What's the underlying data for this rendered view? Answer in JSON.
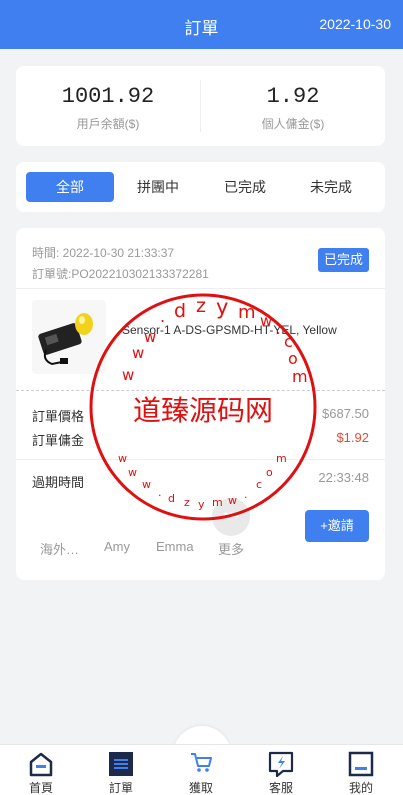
{
  "header": {
    "title": "訂單",
    "date": "2022-10-30"
  },
  "stats": {
    "balance": {
      "value": "1001.92",
      "label": "用戶余額($)"
    },
    "commission": {
      "value": "1.92",
      "label": "個人傭金($)"
    }
  },
  "tabs": [
    {
      "label": "全部",
      "active": true
    },
    {
      "label": "拼團中",
      "active": false
    },
    {
      "label": "已完成",
      "active": false
    },
    {
      "label": "未完成",
      "active": false
    }
  ],
  "order": {
    "time": "時間: 2022-10-30 21:33:37",
    "order_no": "訂單號:PO202210302133372281",
    "status": "已完成",
    "product_name": "Sensor-1 A-DS-GPSMD-HT-YEL, Yellow",
    "price_label": "訂單價格",
    "price_value": "$687.50",
    "commission_label": "訂單傭金",
    "commission_value": "$1.92",
    "expire_label": "過期時間",
    "expire_value": "22:33:48",
    "members": [
      "海外…",
      "Amy",
      "Emma",
      "更多"
    ],
    "invite_label": "+邀請"
  },
  "watermark": {
    "text": "道臻源码网",
    "ring": "w w w . d z y m w . c o m"
  },
  "nav": [
    {
      "label": "首頁",
      "icon": "home-icon"
    },
    {
      "label": "訂單",
      "icon": "order-list-icon"
    },
    {
      "label": "獲取",
      "icon": "cart-icon"
    },
    {
      "label": "客服",
      "icon": "customer-service-icon"
    },
    {
      "label": "我的",
      "icon": "profile-icon"
    }
  ],
  "colors": {
    "primary": "#3f7ff0",
    "price_red": "#e04b3a",
    "stamp_red": "#e01010"
  }
}
